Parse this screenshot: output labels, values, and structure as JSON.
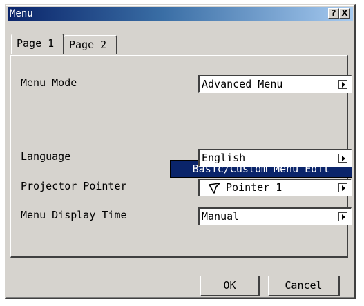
{
  "window": {
    "title": "Menu",
    "help_label": "?",
    "close_label": "X"
  },
  "tabs": [
    {
      "label": "Page 1"
    },
    {
      "label": "Page 2"
    }
  ],
  "settings": {
    "menu_mode": {
      "label": "Menu Mode",
      "value": "Advanced Menu"
    },
    "basic_custom_button": "Basic/Custom Menu Edit",
    "language": {
      "label": "Language",
      "value": "English"
    },
    "projector_pointer": {
      "label": "Projector Pointer",
      "value": "Pointer 1",
      "icon": "pointer-arrow-icon"
    },
    "menu_display_time": {
      "label": "Menu Display Time",
      "value": "Manual"
    }
  },
  "footer": {
    "ok_label": "OK",
    "cancel_label": "Cancel"
  },
  "colors": {
    "title_gradient_start": "#0a246a",
    "title_gradient_end": "#a6caf0",
    "dialog_bg": "#d6d3ce",
    "highlight_button": "#0a246a"
  }
}
